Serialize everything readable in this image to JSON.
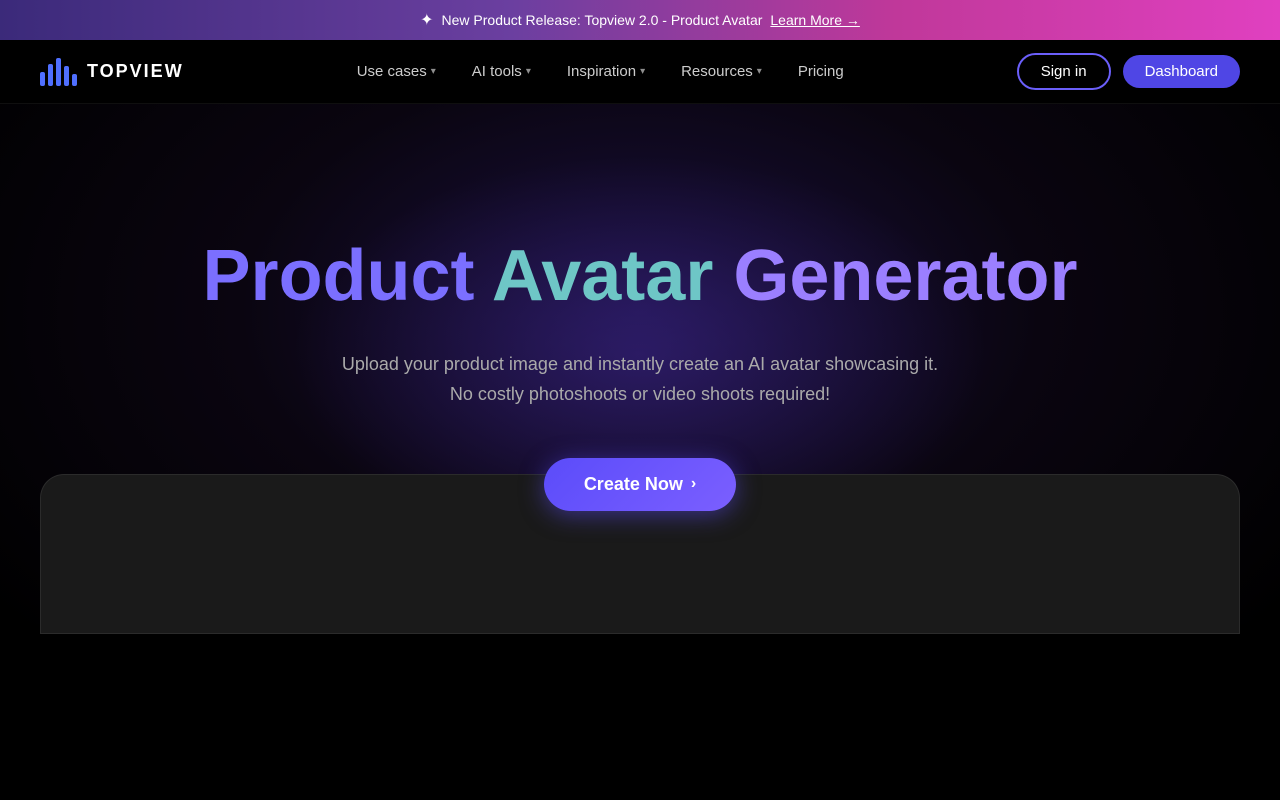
{
  "announcement": {
    "sparkle": "✦",
    "text": "New Product Release: Topview 2.0 - Product Avatar",
    "link_text": "Learn More →"
  },
  "navbar": {
    "logo_text": "TOPVIEW",
    "nav_items": [
      {
        "label": "Use cases",
        "has_dropdown": true
      },
      {
        "label": "AI tools",
        "has_dropdown": true
      },
      {
        "label": "Inspiration",
        "has_dropdown": true
      },
      {
        "label": "Resources",
        "has_dropdown": true
      },
      {
        "label": "Pricing",
        "has_dropdown": false
      }
    ],
    "signin_label": "Sign in",
    "dashboard_label": "Dashboard"
  },
  "hero": {
    "title_part1": "Product",
    "title_part2": "Avatar",
    "title_part3": "Generator",
    "subtitle_line1": "Upload your product image and instantly create an AI avatar showcasing it.",
    "subtitle_line2": "No costly photoshoots or video shoots required!",
    "cta_label": "Create Now",
    "cta_chevron": "›"
  }
}
